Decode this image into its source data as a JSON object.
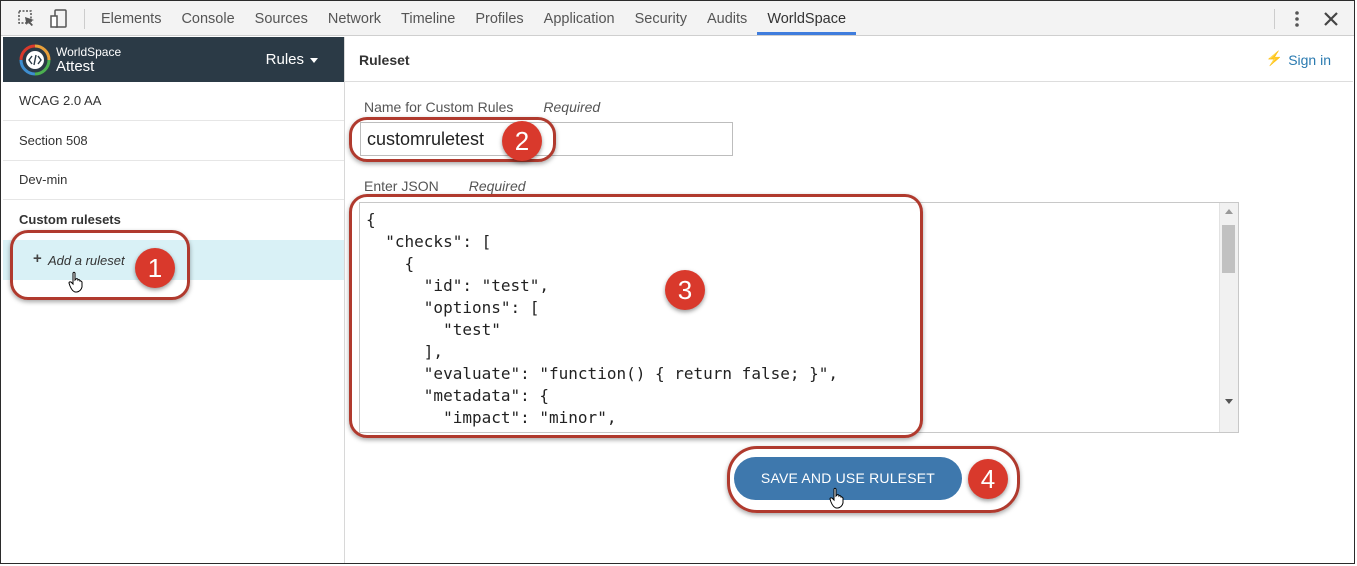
{
  "devtools": {
    "tabs": [
      "Elements",
      "Console",
      "Sources",
      "Network",
      "Timeline",
      "Profiles",
      "Application",
      "Security",
      "Audits",
      "WorldSpace"
    ],
    "active_tab": "WorldSpace"
  },
  "brand": {
    "line1": "WorldSpace",
    "line2": "Attest",
    "menu_label": "Rules"
  },
  "sidebar": {
    "items": [
      {
        "label": "WCAG 2.0 AA"
      },
      {
        "label": "Section 508"
      },
      {
        "label": "Dev-min"
      },
      {
        "label": "Custom rulesets"
      }
    ],
    "add_label": "Add a ruleset"
  },
  "main": {
    "title": "Ruleset",
    "signin_label": "Sign in",
    "name_label": "Name for Custom Rules",
    "name_required": "Required",
    "name_value": "customruletest",
    "json_label": "Enter JSON",
    "json_required": "Required",
    "json_value": "{\n  \"checks\": [\n    {\n      \"id\": \"test\",\n      \"options\": [\n        \"test\"\n      ],\n      \"evaluate\": \"function() { return false; }\",\n      \"metadata\": {\n        \"impact\": \"minor\",",
    "save_label": "SAVE AND USE RULESET"
  },
  "annotations": [
    "1",
    "2",
    "3",
    "4"
  ],
  "colors": {
    "brand_bg": "#2b3a46",
    "accent": "#3e78ad",
    "callout": "#d9392c",
    "selected_row": "#d9f1f6"
  }
}
